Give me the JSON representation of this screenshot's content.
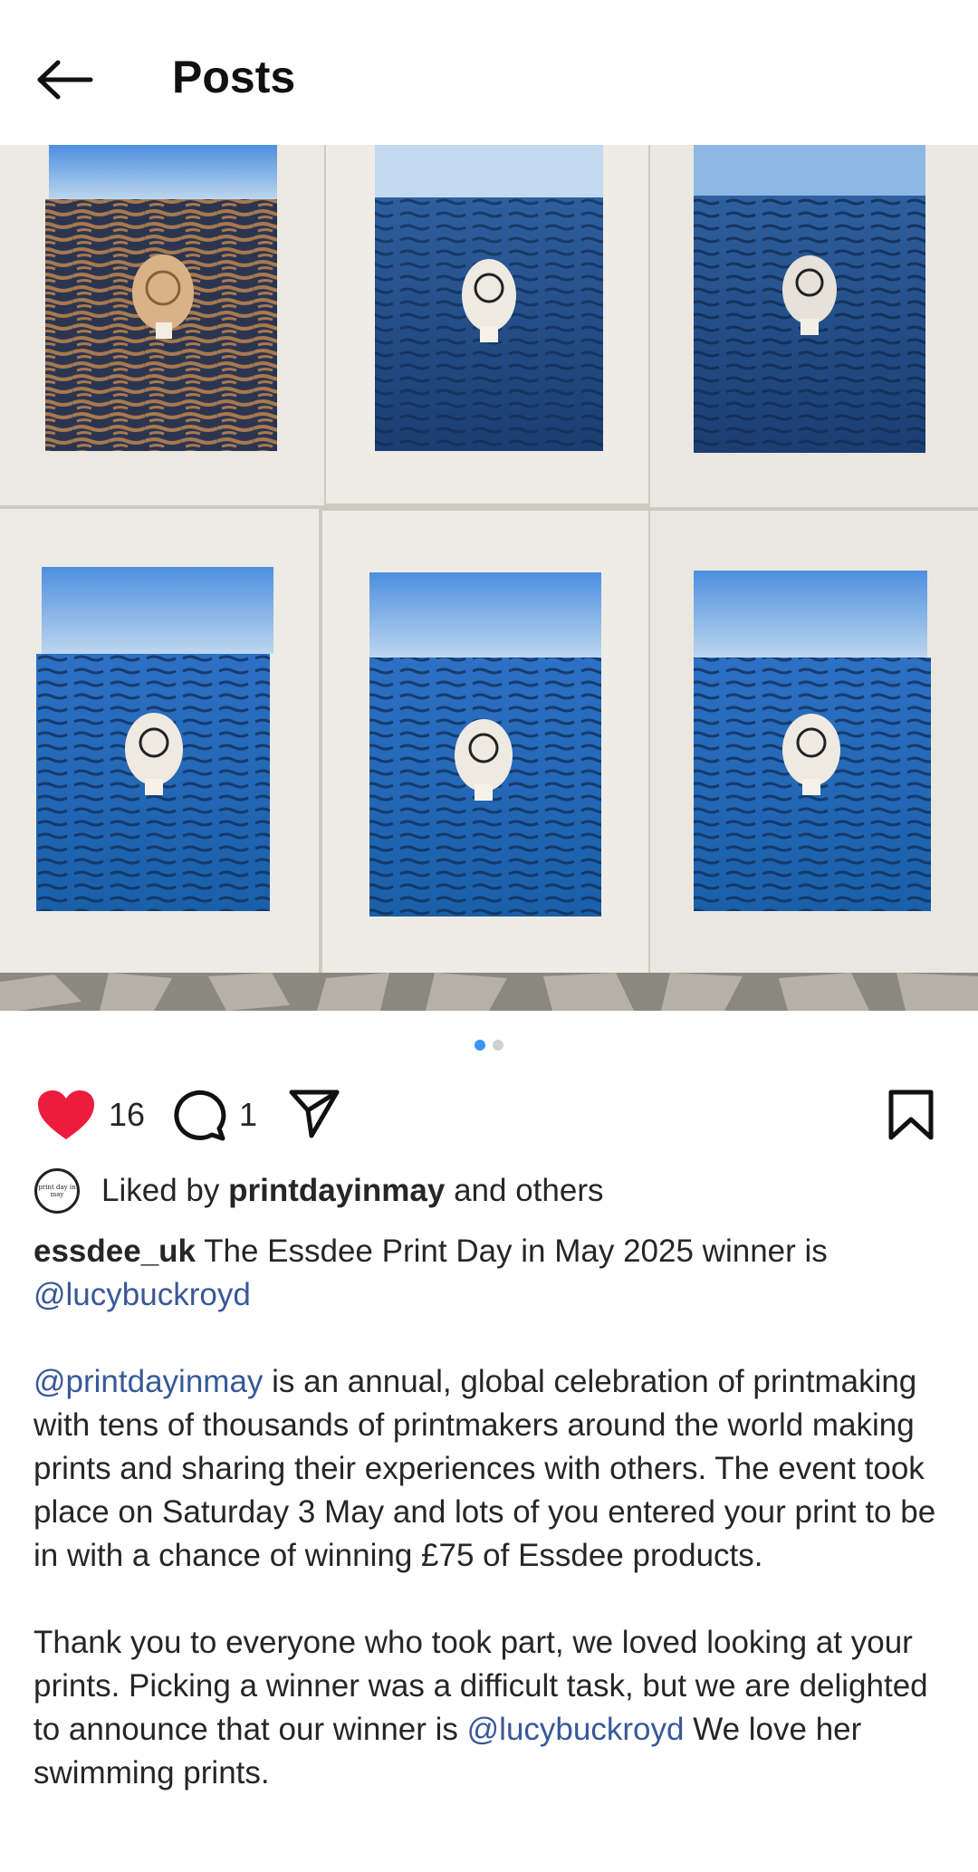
{
  "header": {
    "title": "Posts",
    "back_icon": "arrow-left-icon"
  },
  "post": {
    "image_description_icon": "photo",
    "carousel": {
      "count": 2,
      "active_index": 0
    },
    "actions": {
      "like_count": "16",
      "comment_count": "1",
      "liked": true,
      "like_color": "#ed1c3c"
    },
    "liked_by": {
      "prefix": "Liked by",
      "user": "printdayinmay",
      "suffix": "and others",
      "avatar_text": "print day in may"
    },
    "caption": {
      "username": "essdee_uk",
      "line1_text": "The Essdee Print Day in May 2025 winner is",
      "line1_mention": "@lucybuckroyd",
      "para2_mention": "@printdayinmay",
      "para2_text": "is an annual, global celebration of printmaking with tens of thousands of printmakers around the world making prints and sharing their experiences with others. The event took place on Saturday 3 May and lots of you entered your print to be in with a chance of winning £75 of Essdee products.",
      "para3_text": "Thank you to everyone who took part, we loved looking at your prints.  Picking a winner was a difficult task, but we are delighted to announce that our winner is",
      "para3_mention": "@lucybuckroyd",
      "para3_end": "We love her swimming prints."
    }
  },
  "colors": {
    "mention": "#385898",
    "dot_active": "#3897f0"
  }
}
